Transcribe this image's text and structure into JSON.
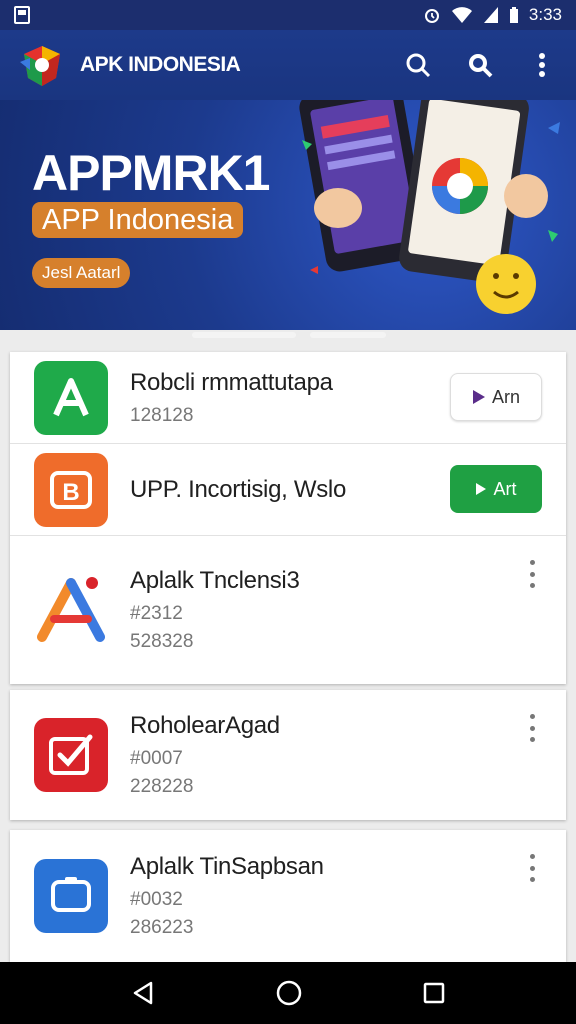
{
  "status_bar": {
    "time": "3:33"
  },
  "app_bar": {
    "brand": "APK INDONESIA"
  },
  "banner": {
    "title": "APPMRK1",
    "subtitle": "APP Indonesia",
    "button_label": "Jesl Aatarl"
  },
  "apps_card1": [
    {
      "name": "Robcli rmmattutapa",
      "meta": "128128",
      "action_label": "Arn",
      "icon": "letter-a-icon",
      "color": "#1faa4a"
    },
    {
      "name": "UPP. Incortisig, Wslo",
      "meta": "",
      "action_label": "Art",
      "icon": "letter-b-icon",
      "color": "#ef6c2b"
    },
    {
      "name": "Aplalk Tnclensi3",
      "meta": "#2312",
      "meta2": "528328",
      "icon": "triangle-a-icon"
    }
  ],
  "apps_card2": [
    {
      "name": "RoholearAgad",
      "meta": "#0007",
      "meta2": "228228",
      "icon": "checkbox-icon",
      "color": "#d9232a"
    }
  ],
  "apps_card3": [
    {
      "name": "Aplalk TinSapbsan",
      "meta": "#0032",
      "meta2": "286223",
      "icon": "tablet-icon",
      "color": "#2a73d6"
    }
  ],
  "colors": {
    "app_bar": "#1d3a8a",
    "banner": "#1c3a8d",
    "accent_orange": "#d6802c",
    "install_green": "#1fa043"
  }
}
